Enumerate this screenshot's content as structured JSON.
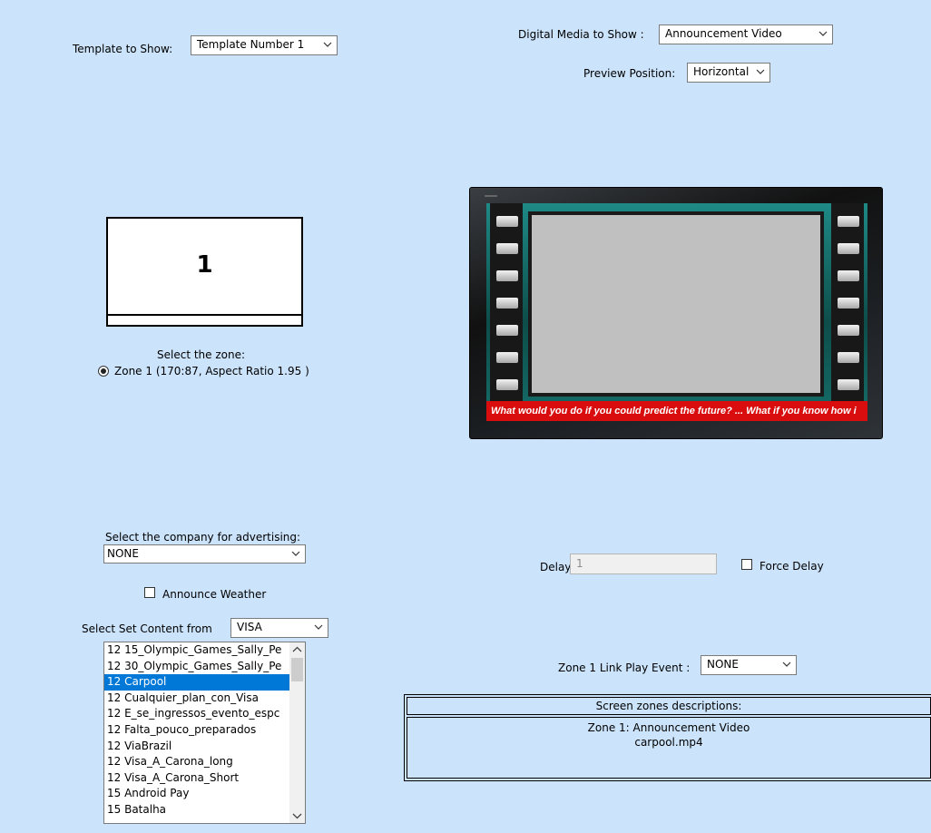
{
  "template": {
    "label": "Template to Show:",
    "selected": "Template Number 1"
  },
  "media": {
    "label": "Digital Media to Show :",
    "selected": "Announcement Video"
  },
  "preview": {
    "label": "Preview Position:",
    "selected": "Horizontal"
  },
  "zone_preview": {
    "number": "1"
  },
  "zone_select": {
    "title": "Select the zone:",
    "option": "Zone 1 (170:87, Aspect Ratio 1.95 )"
  },
  "tv": {
    "ticker": "What would you do if you could predict the future? ... What if you know how i"
  },
  "company": {
    "label": "Select the company for advertising:",
    "selected": "NONE"
  },
  "weather": {
    "label": "Announce Weather",
    "checked": false
  },
  "set_content": {
    "label": "Select Set Content  from",
    "selected": "VISA"
  },
  "content_list": {
    "items": [
      "12 15_Olympic_Games_Sally_Pe",
      "12 30_Olympic_Games_Sally_Pe",
      "12 Carpool",
      "12 Cualquier_plan_con_Visa",
      "12 E_se_ingressos_evento_espc",
      "12 Falta_pouco_preparados",
      "12 ViaBrazil",
      "12 Visa_A_Carona_long",
      "12 Visa_A_Carona_Short",
      "15 Android Pay",
      "15 Batalha"
    ],
    "selected": "12 Carpool"
  },
  "delay": {
    "label": "Delay:",
    "value": "1"
  },
  "force_delay": {
    "label": "Force Delay",
    "checked": false
  },
  "link_event": {
    "label": "Zone 1 Link Play Event :",
    "selected": "NONE"
  },
  "zones_table": {
    "header": "Screen zones descriptions:",
    "line1": "Zone 1: Announcement Video",
    "line2": "carpool.mp4"
  }
}
